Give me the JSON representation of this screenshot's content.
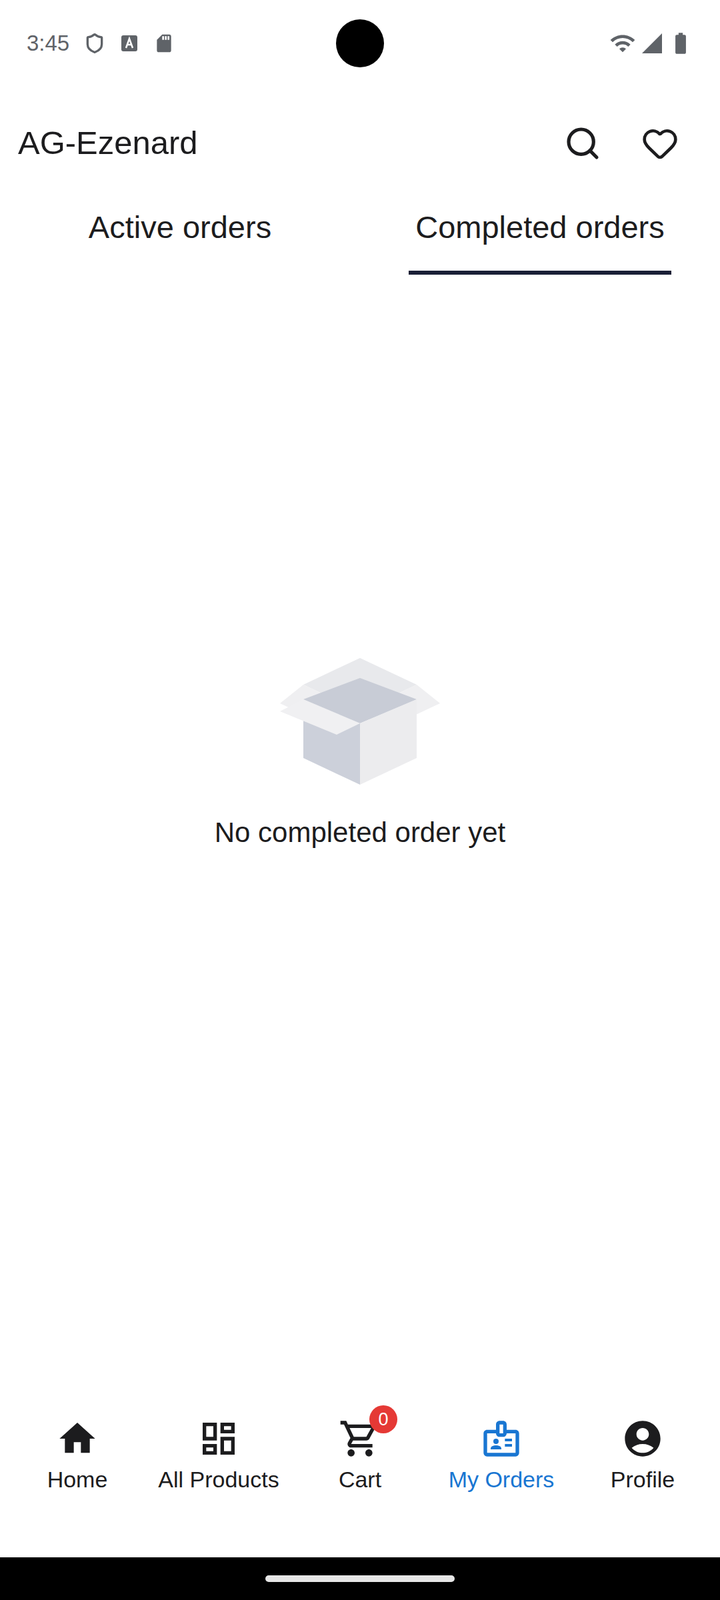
{
  "status_bar": {
    "time": "3:45"
  },
  "header": {
    "title": "AG-Ezenard"
  },
  "tabs": [
    {
      "label": "Active orders",
      "selected": false
    },
    {
      "label": "Completed orders",
      "selected": true
    }
  ],
  "empty_state": {
    "message": "No completed order yet"
  },
  "bottom_nav": [
    {
      "label": "Home",
      "selected": false,
      "badge": ""
    },
    {
      "label": "All Products",
      "selected": false,
      "badge": ""
    },
    {
      "label": "Cart",
      "selected": false,
      "badge": "0"
    },
    {
      "label": "My Orders",
      "selected": true,
      "badge": ""
    },
    {
      "label": "Profile",
      "selected": false,
      "badge": ""
    }
  ]
}
